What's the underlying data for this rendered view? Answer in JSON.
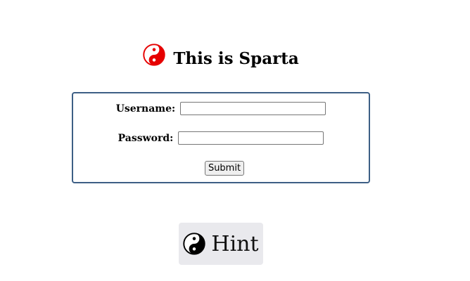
{
  "header": {
    "title": "This is Sparta",
    "logo_icon": "yin-yang-icon",
    "logo_color": "#e60000"
  },
  "login_form": {
    "username_label": "Username:",
    "username_value": "",
    "password_label": "Password:",
    "password_value": "",
    "submit_label": "Submit",
    "border_color": "#3d5f85"
  },
  "hint": {
    "icon": "yin-yang-icon",
    "label": "Hint"
  }
}
